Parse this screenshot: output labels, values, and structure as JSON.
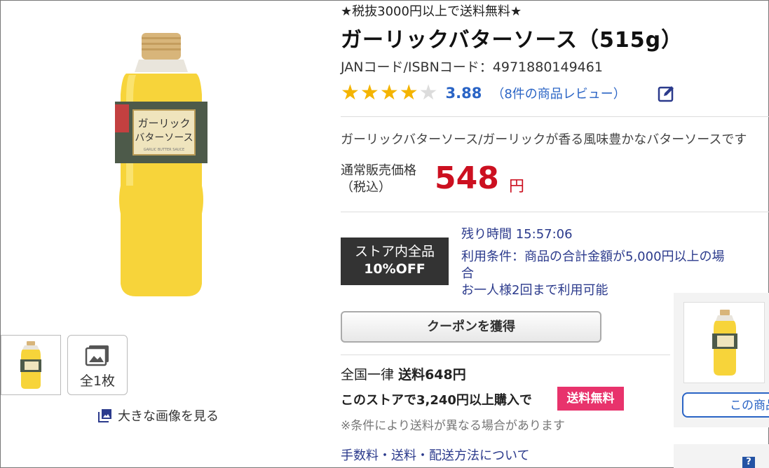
{
  "promo_banner": "★税抜3000円以上で送料無料★",
  "product": {
    "title": "ガーリックバターソース（515g）",
    "jan": "JANコード/ISBNコード：4971880149461",
    "rating": "3.88",
    "rating_stars": 3.88,
    "review_link": "（8件の商品レビュー）",
    "description": "ガーリックバターソース/ガーリックが香る風味豊かなバターソースです",
    "bottle_label_line1": "ガーリック",
    "bottle_label_line2": "バターソース",
    "bottle_label_en": "GARLIC BUTTER SAUCE"
  },
  "price": {
    "label_line1": "通常販売価格",
    "label_line2": "（税込）",
    "value": "548",
    "unit": "円"
  },
  "coupon": {
    "badge_line1": "ストア内全品",
    "badge_line2": "10%OFF",
    "remaining": "残り時間 15:57:06",
    "condition_line1": "利用条件：商品の合計金額が5,000円以上の場合",
    "condition_line2": "お一人様2回まで利用可能",
    "button_label": "クーポンを獲得"
  },
  "shipping": {
    "line1_prefix": "全国一律",
    "line1_value": "送料648円",
    "line2": "このストアで3,240円以上購入で",
    "free_badge": "送料無料",
    "note": "※条件により送料が異なる場合があります",
    "fee_link": "手数料・送料・配送方法について"
  },
  "gallery": {
    "all_count": "全1枚",
    "view_large": "大きな画像を見る"
  },
  "side": {
    "button_label": "この商品"
  },
  "colors": {
    "price_red": "#cc1020",
    "link_blue": "#2a64c5",
    "star_gold": "#f4b400",
    "badge_pink": "#e8336c",
    "coupon_dark": "#333333"
  },
  "icons": [
    "image-gallery-icon",
    "photo-icon",
    "edit-icon",
    "star-icon",
    "help-icon"
  ]
}
